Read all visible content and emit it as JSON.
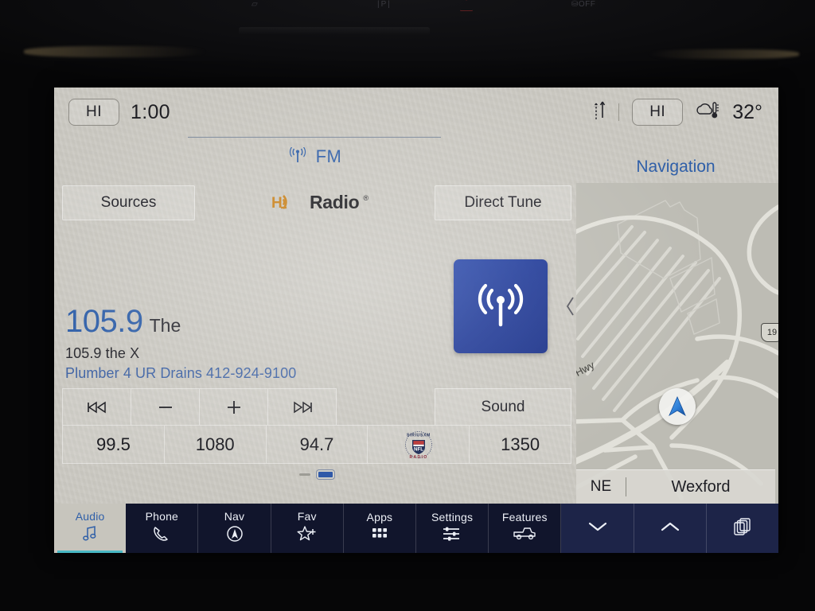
{
  "status_bar": {
    "left_climate_label": "HI",
    "clock": "1:00",
    "transfer_icon": "arrows-up-down-icon",
    "right_climate_label": "HI",
    "weather_icon": "cloud-thermometer-icon",
    "temperature": "32°"
  },
  "source_header": {
    "band_icon": "radio-antenna-icon",
    "band": "FM"
  },
  "audio": {
    "sources_label": "Sources",
    "hd_radio_logo_text": "Radio",
    "hd_radio_mark": "HD",
    "hd_radio_registered": "®",
    "direct_tune_label": "Direct Tune",
    "sound_label": "Sound",
    "signal_tile_icon": "broadcast-tower-icon",
    "station": {
      "frequency": "105.9",
      "suffix": "The",
      "name": "105.9 the X",
      "metadata": "Plumber 4 UR Drains 412-924-9100"
    },
    "transport": [
      {
        "name": "previous-station-button",
        "glyph": "◅◅|"
      },
      {
        "name": "seek-down-button",
        "glyph": "—"
      },
      {
        "name": "seek-up-button",
        "glyph": "+"
      },
      {
        "name": "next-station-button",
        "glyph": "|▻▻"
      }
    ],
    "presets": [
      {
        "label": "99.5",
        "type": "text"
      },
      {
        "label": "1080",
        "type": "text"
      },
      {
        "label": "94.7",
        "type": "text"
      },
      {
        "label": "SIRIUSXM NFL RADIO",
        "type": "logo"
      },
      {
        "label": "1350",
        "type": "text"
      }
    ],
    "preset_page": {
      "current": 2,
      "total": 2
    }
  },
  "navigation": {
    "title": "Navigation",
    "heading": "NE",
    "place": "Wexford",
    "road_label": "Hwy",
    "highway_shield": "19",
    "position_icon": "navigation-arrow-icon",
    "collapse_icon": "chevron-left-icon"
  },
  "bottom_bar": {
    "items": [
      {
        "label": "Audio",
        "icon": "music-note-icon",
        "active": true
      },
      {
        "label": "Phone",
        "icon": "phone-handset-icon",
        "active": false
      },
      {
        "label": "Nav",
        "icon": "compass-icon",
        "active": false
      },
      {
        "label": "Fav",
        "icon": "star-plus-icon",
        "active": false
      },
      {
        "label": "Apps",
        "icon": "grid-apps-icon",
        "active": false
      },
      {
        "label": "Settings",
        "icon": "sliders-icon",
        "active": false
      },
      {
        "label": "Features",
        "icon": "truck-icon",
        "active": false
      }
    ],
    "controls": [
      {
        "label": "",
        "icon": "chevron-down-icon"
      },
      {
        "label": "",
        "icon": "chevron-up-icon"
      },
      {
        "label": "",
        "icon": "stacked-cards-icon"
      }
    ]
  },
  "colors": {
    "accent_blue": "#2f5fa8",
    "tile_blue": "#1e3896",
    "bottom_bar": "#11152c",
    "active_tab_underline": "#49b8c4",
    "screen_bg": "#c9c7c0"
  }
}
